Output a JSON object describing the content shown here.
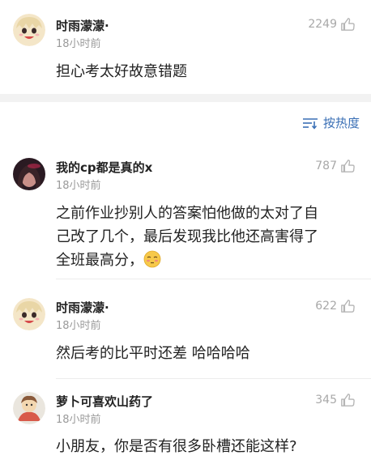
{
  "top_comment": {
    "username": "时雨濛濛·",
    "time": "18小时前",
    "likes": "2249",
    "text": "担心考太好故意错题"
  },
  "sort_bar": {
    "label": "按热度",
    "icon": "sort-lines-icon"
  },
  "comments": [
    {
      "username": "我的cp都是真的x",
      "time": "18小时前",
      "likes": "787",
      "text_line1": "之前作业抄别人的答案怕他做的太对了自",
      "text_line2": "己改了几个，最后发现我比他还高害得了",
      "text_line3": "全班最高分，",
      "emoji": "embarrassed-face-emoji"
    },
    {
      "username": "时雨濛濛·",
      "time": "18小时前",
      "likes": "622",
      "text": "然后考的比平时还差 哈哈哈哈"
    },
    {
      "username": "萝卜可喜欢山药了",
      "time": "18小时前",
      "likes": "345",
      "text": "小朋友，你是否有很多卧槽还能这样?"
    }
  ],
  "colors": {
    "accent": "#3a6fb5",
    "muted": "#9a9a9a",
    "section_bg": "#f2f2f2"
  }
}
